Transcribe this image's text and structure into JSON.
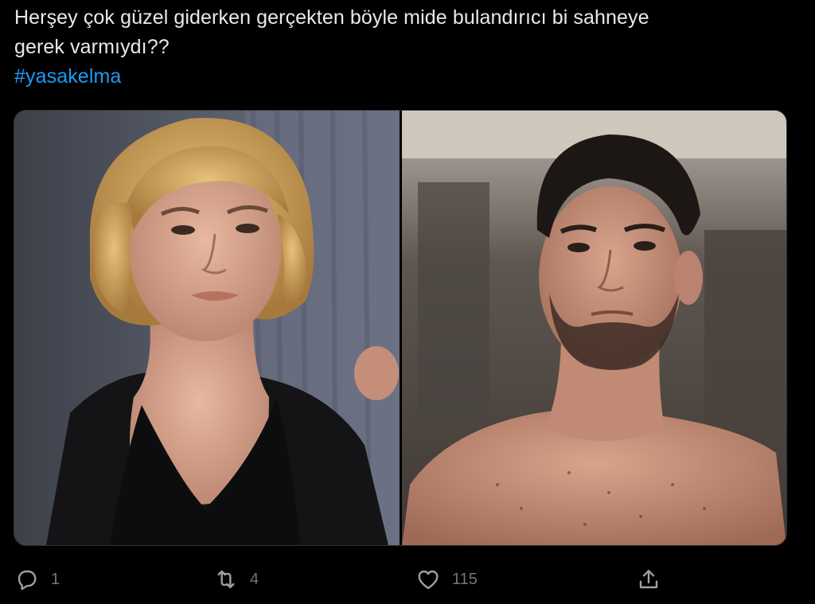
{
  "tweet": {
    "text_line1": "Herşey çok güzel giderken gerçekten böyle mide bulandırıcı bi sahneye",
    "text_line2": "gerek varmıydı??",
    "hashtag": "#yasakelma"
  },
  "actions": {
    "reply_count": "1",
    "retweet_count": "4",
    "like_count": "115"
  },
  "colors": {
    "background": "#000000",
    "text": "#e7e9ea",
    "link": "#1d9bf0",
    "muted": "#71767b"
  },
  "icons": [
    "reply-icon",
    "retweet-icon",
    "like-icon",
    "share-icon"
  ]
}
